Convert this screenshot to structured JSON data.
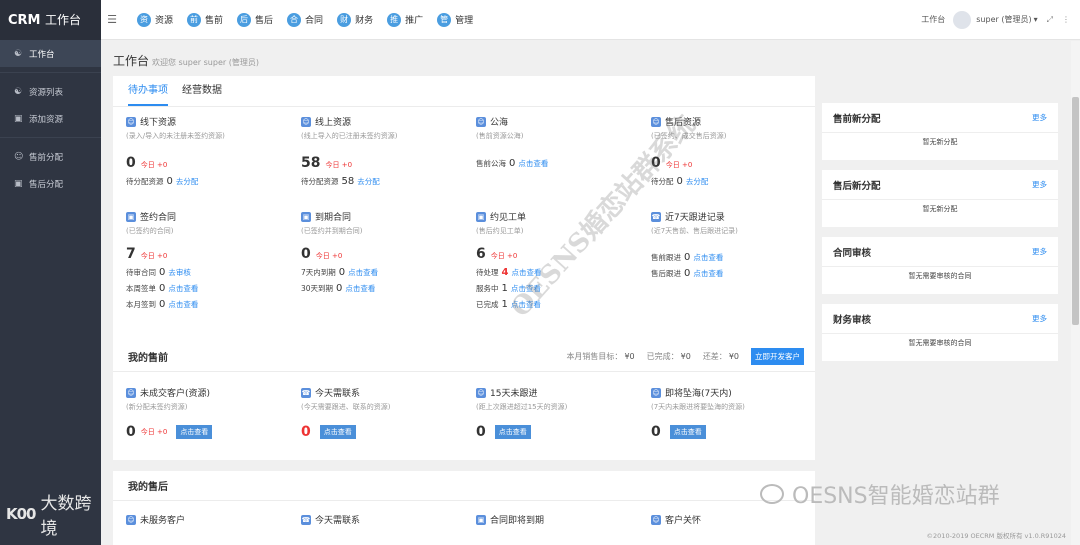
{
  "sidebar": {
    "brand": "CRM",
    "brand_sub": "工作台",
    "items": [
      {
        "label": "工作台",
        "icon": "users-icon"
      },
      {
        "label": "资源列表",
        "icon": "users-icon"
      },
      {
        "label": "添加资源",
        "icon": "document-icon"
      },
      {
        "label": "售前分配",
        "icon": "user-icon"
      },
      {
        "label": "售后分配",
        "icon": "document-icon"
      }
    ],
    "watermark": "大数跨境"
  },
  "topbar": {
    "nav": [
      {
        "label": "资源",
        "icon": "资"
      },
      {
        "label": "售前",
        "icon": "前"
      },
      {
        "label": "售后",
        "icon": "后"
      },
      {
        "label": "合同",
        "icon": "合"
      },
      {
        "label": "财务",
        "icon": "财"
      },
      {
        "label": "推广",
        "icon": "推"
      },
      {
        "label": "管理",
        "icon": "管"
      }
    ],
    "workspace": "工作台",
    "user": "super (管理员)"
  },
  "page": {
    "title": "工作台",
    "subtitle": "欢迎您 super super (管理员)"
  },
  "todo": {
    "tabs": [
      "待办事项",
      "经营数据"
    ],
    "today": "今日",
    "cells": [
      {
        "title": "线下资源",
        "desc": "(录入/导入的未注册未签约资源)",
        "num": "0",
        "today": "+0",
        "l1": "待分配资源",
        "v1": "0",
        "k1": "去分配"
      },
      {
        "title": "线上资源",
        "desc": "(线上导入的已注册未签约资源)",
        "num": "58",
        "today": "+0",
        "l1": "待分配资源",
        "v1": "58",
        "k1": "去分配"
      },
      {
        "title": "公海",
        "desc": "(售前资源公海)",
        "l1": "售前公海",
        "v1": "0",
        "k1": "点击查看"
      },
      {
        "title": "售后资源",
        "desc": "(已签约、成交售后资源)",
        "num": "0",
        "today": "+0",
        "l1": "待分配",
        "v1": "0",
        "k1": "去分配"
      },
      {
        "title": "签约合同",
        "desc": "(已签约的合同)",
        "num": "7",
        "today": "+0",
        "l1": "待审合同",
        "v1": "0",
        "k1": "去审核",
        "l2": "本周签单",
        "v2": "0",
        "k2": "点击查看",
        "l3": "本月签到",
        "v3": "0",
        "k3": "点击查看"
      },
      {
        "title": "到期合同",
        "desc": "(已签约并到期合同)",
        "num": "0",
        "today": "+0",
        "l1": "7天内到期",
        "v1": "0",
        "k1": "点击查看",
        "l2": "30天到期",
        "v2": "0",
        "k2": "点击查看"
      },
      {
        "title": "约见工单",
        "desc": "(售后约见工单)",
        "num": "6",
        "today": "+0",
        "l1": "待处理",
        "v1": "4",
        "k1": "点击查看",
        "l2": "服务中",
        "v2": "1",
        "k2": "点击查看",
        "l3": "已完成",
        "v3": "1",
        "k3": "点击查看"
      },
      {
        "title": "近7天跟进记录",
        "desc": "(近7天售前、售后跟进记录)",
        "l1": "售前跟进",
        "v1": "0",
        "k1": "点击查看",
        "l2": "售后跟进",
        "v2": "0",
        "k2": "点击查看"
      }
    ]
  },
  "right": [
    {
      "title": "售前新分配",
      "more": "更多",
      "empty": "暂无新分配"
    },
    {
      "title": "售后新分配",
      "more": "更多",
      "empty": "暂无新分配"
    },
    {
      "title": "合同审核",
      "more": "更多",
      "empty": "暂无需要审核的合同"
    },
    {
      "title": "财务审核",
      "more": "更多",
      "empty": "暂无需要审核的合同"
    }
  ],
  "sales": {
    "title": "我的售前",
    "target_label": "本月销售目标：",
    "target": "¥0",
    "done_label": "已完成：",
    "done": "¥0",
    "diff_label": "还差：",
    "diff": "¥0",
    "btn": "立即开发客户",
    "cells": [
      {
        "title": "未成交客户(资源)",
        "desc": "(新分配未签约资源)",
        "num": "0",
        "today": "+0",
        "btn": "点击查看"
      },
      {
        "title": "今天需联系",
        "desc": "(今天需要跟进、联系的资源)",
        "num": "0",
        "btn": "点击查看"
      },
      {
        "title": "15天未跟进",
        "desc": "(距上次跟进超过15天的资源)",
        "num": "0",
        "btn": "点击查看"
      },
      {
        "title": "即将坠海(7天内)",
        "desc": "(7天内未跟进将要坠海的资源)",
        "num": "0",
        "btn": "点击查看"
      }
    ]
  },
  "after": {
    "title": "我的售后",
    "cells": [
      "未服务客户",
      "今天需联系",
      "合同即将到期",
      "客户关怀"
    ]
  },
  "watermark": {
    "diagonal": "OESNS婚恋站群系统",
    "logo": "OESNS智能婚恋站群"
  },
  "footer": "©2010-2019 OECRM 版权所有 v1.0.R91024"
}
